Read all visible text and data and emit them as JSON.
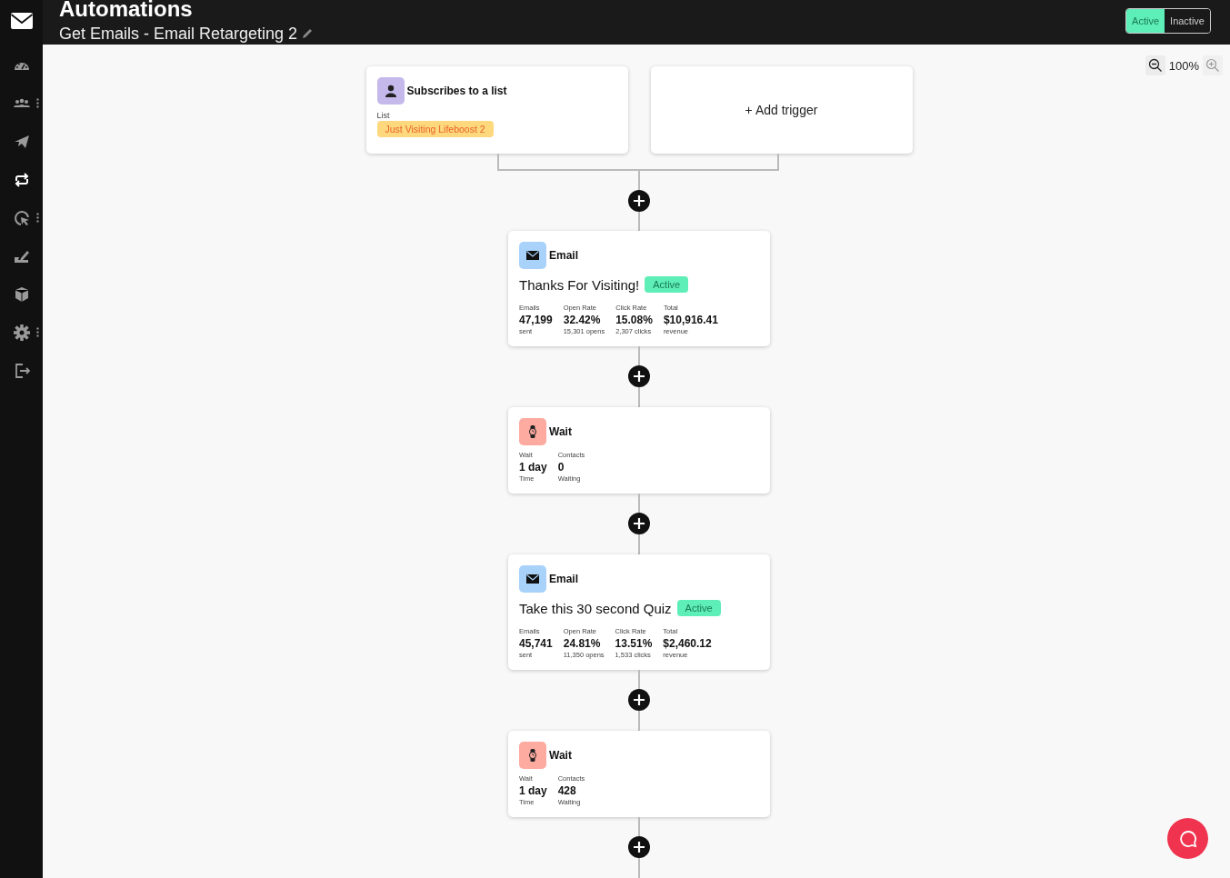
{
  "header": {
    "title": "Automations",
    "subtitle": "Get Emails - Email Retargeting 2"
  },
  "status_toggle": [
    {
      "label": "Active",
      "selected": true
    },
    {
      "label": "Inactive",
      "selected": false
    }
  ],
  "sidebar": {
    "items": [
      {
        "selected": false,
        "has_submenu": false
      },
      {
        "selected": false,
        "has_submenu": true
      },
      {
        "selected": false,
        "has_submenu": false
      },
      {
        "selected": true,
        "has_submenu": false
      },
      {
        "selected": false,
        "has_submenu": true
      },
      {
        "selected": false,
        "has_submenu": false
      },
      {
        "selected": false,
        "has_submenu": false
      },
      {
        "selected": false,
        "has_submenu": true
      },
      {
        "selected": false,
        "has_submenu": false
      }
    ]
  },
  "zoom": {
    "level_text": "100%"
  },
  "triggers": [
    {
      "kind": "list",
      "title": "Subscribes to a list",
      "field_label": "List",
      "tag": "Just Visiting Lifeboost 2"
    },
    {
      "kind": "add",
      "label": "+ Add trigger"
    }
  ],
  "steps": [
    {
      "kind": "email",
      "type_label": "Email",
      "name": "Thanks For Visiting!",
      "status": "Active",
      "active": true,
      "stats": [
        {
          "label": "Emails",
          "value": "47,199",
          "sub": "sent"
        },
        {
          "label": "Open Rate",
          "value": "32.42%",
          "sub": "15,301 opens"
        },
        {
          "label": "Click Rate",
          "value": "15.08%",
          "sub": "2,307 clicks"
        },
        {
          "label": "Total",
          "value": "$10,916.41",
          "sub": "revenue"
        }
      ]
    },
    {
      "kind": "wait",
      "type_label": "Wait",
      "stats": [
        {
          "label": "Wait",
          "value": "1 day",
          "sub": "Time"
        },
        {
          "label": "Contacts",
          "value": "0",
          "sub": "Waiting"
        }
      ]
    },
    {
      "kind": "email",
      "type_label": "Email",
      "name": "Take this 30 second Quiz",
      "status": "Active",
      "active": true,
      "stats": [
        {
          "label": "Emails",
          "value": "45,741",
          "sub": "sent"
        },
        {
          "label": "Open Rate",
          "value": "24.81%",
          "sub": "11,350 opens"
        },
        {
          "label": "Click Rate",
          "value": "13.51%",
          "sub": "1,533 clicks"
        },
        {
          "label": "Total",
          "value": "$2,460.12",
          "sub": "revenue"
        }
      ]
    },
    {
      "kind": "wait",
      "type_label": "Wait",
      "stats": [
        {
          "label": "Wait",
          "value": "1 day",
          "sub": "Time"
        },
        {
          "label": "Contacts",
          "value": "428",
          "sub": "Waiting"
        }
      ]
    }
  ]
}
